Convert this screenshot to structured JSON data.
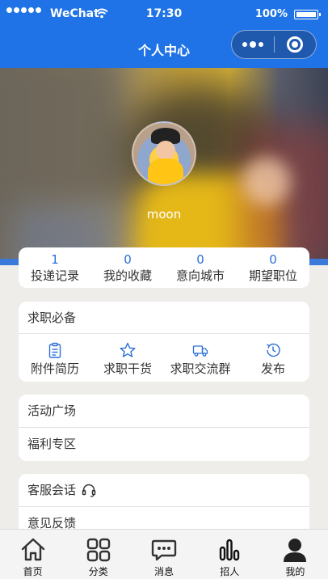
{
  "status_bar": {
    "carrier": "WeChat",
    "time": "17:30",
    "battery": "100%"
  },
  "nav": {
    "title": "个人中心"
  },
  "profile": {
    "username": "moon"
  },
  "stats": [
    {
      "value": "1",
      "label": "投递记录"
    },
    {
      "value": "0",
      "label": "我的收藏"
    },
    {
      "value": "0",
      "label": "意向城市"
    },
    {
      "value": "0",
      "label": "期望职位"
    }
  ],
  "essentials": {
    "title": "求职必备",
    "items": [
      {
        "label": "附件简历",
        "icon": "clipboard-icon"
      },
      {
        "label": "求职干货",
        "icon": "star-icon"
      },
      {
        "label": "求职交流群",
        "icon": "truck-icon"
      },
      {
        "label": "发布",
        "icon": "clock-icon"
      }
    ]
  },
  "menu1": {
    "items": [
      "活动广场",
      "福利专区"
    ]
  },
  "menu2": {
    "items": [
      "客服会话",
      "意见反馈"
    ],
    "support_icon": "headset-icon"
  },
  "tabs": [
    {
      "label": "首页",
      "icon": "home-icon"
    },
    {
      "label": "分类",
      "icon": "grid-icon"
    },
    {
      "label": "消息",
      "icon": "message-icon"
    },
    {
      "label": "招人",
      "icon": "bar-chart-icon"
    },
    {
      "label": "我的",
      "icon": "person-icon"
    }
  ],
  "colors": {
    "primary": "#1f73e6",
    "accent_text": "#2b6fd8",
    "background": "#efedea"
  }
}
